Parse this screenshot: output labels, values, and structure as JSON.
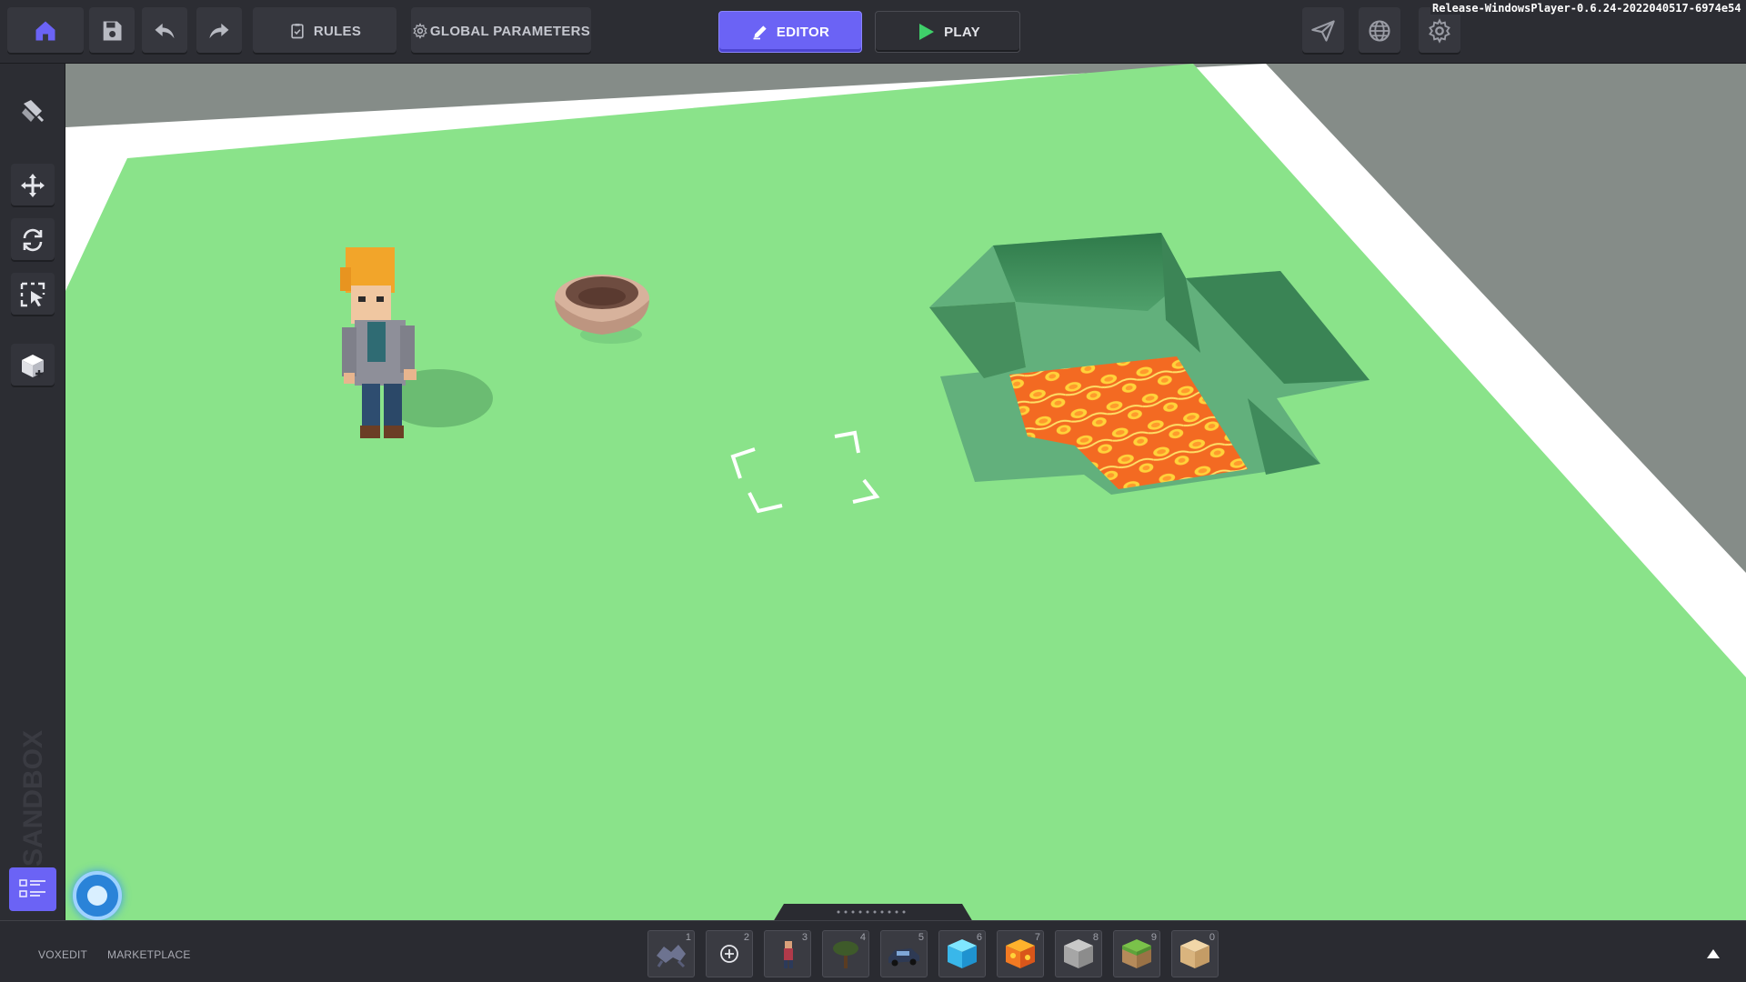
{
  "toolbar": {
    "rules_label": "RULES",
    "global_parameters_label": "GLOBAL PARAMETERS",
    "editor_label": "EDITOR",
    "play_label": "PLAY",
    "accent_color": "#6b63f5",
    "play_icon_color": "#3fd06a"
  },
  "version": "Release-WindowsPlayer-0.6.24-2022040517-6974e54",
  "sidebar": {
    "brand": "SANDBOX",
    "tools": [
      {
        "icon": "paint-brush-icon"
      },
      {
        "icon": "move-icon"
      },
      {
        "icon": "rotate-icon"
      },
      {
        "icon": "select-icon"
      },
      {
        "icon": "add-cube-icon"
      }
    ]
  },
  "footer": {
    "voxedit_label": "VOXEDIT",
    "marketplace_label": "MARKETPLACE"
  },
  "hotbar": {
    "slots": [
      {
        "num": "1",
        "icon": "creature-icon"
      },
      {
        "num": "2",
        "icon": "add-icon"
      },
      {
        "num": "3",
        "icon": "character-icon"
      },
      {
        "num": "4",
        "icon": "tree-icon"
      },
      {
        "num": "5",
        "icon": "car-icon"
      },
      {
        "num": "6",
        "icon": "ice-block-icon"
      },
      {
        "num": "7",
        "icon": "lava-block-icon"
      },
      {
        "num": "8",
        "icon": "stone-block-icon"
      },
      {
        "num": "9",
        "icon": "grass-block-icon"
      },
      {
        "num": "0",
        "icon": "sand-block-icon"
      }
    ]
  },
  "colors": {
    "ground": "#8ae38a",
    "lava": "#f0782a",
    "pit_wall": "#3f8a5b"
  }
}
